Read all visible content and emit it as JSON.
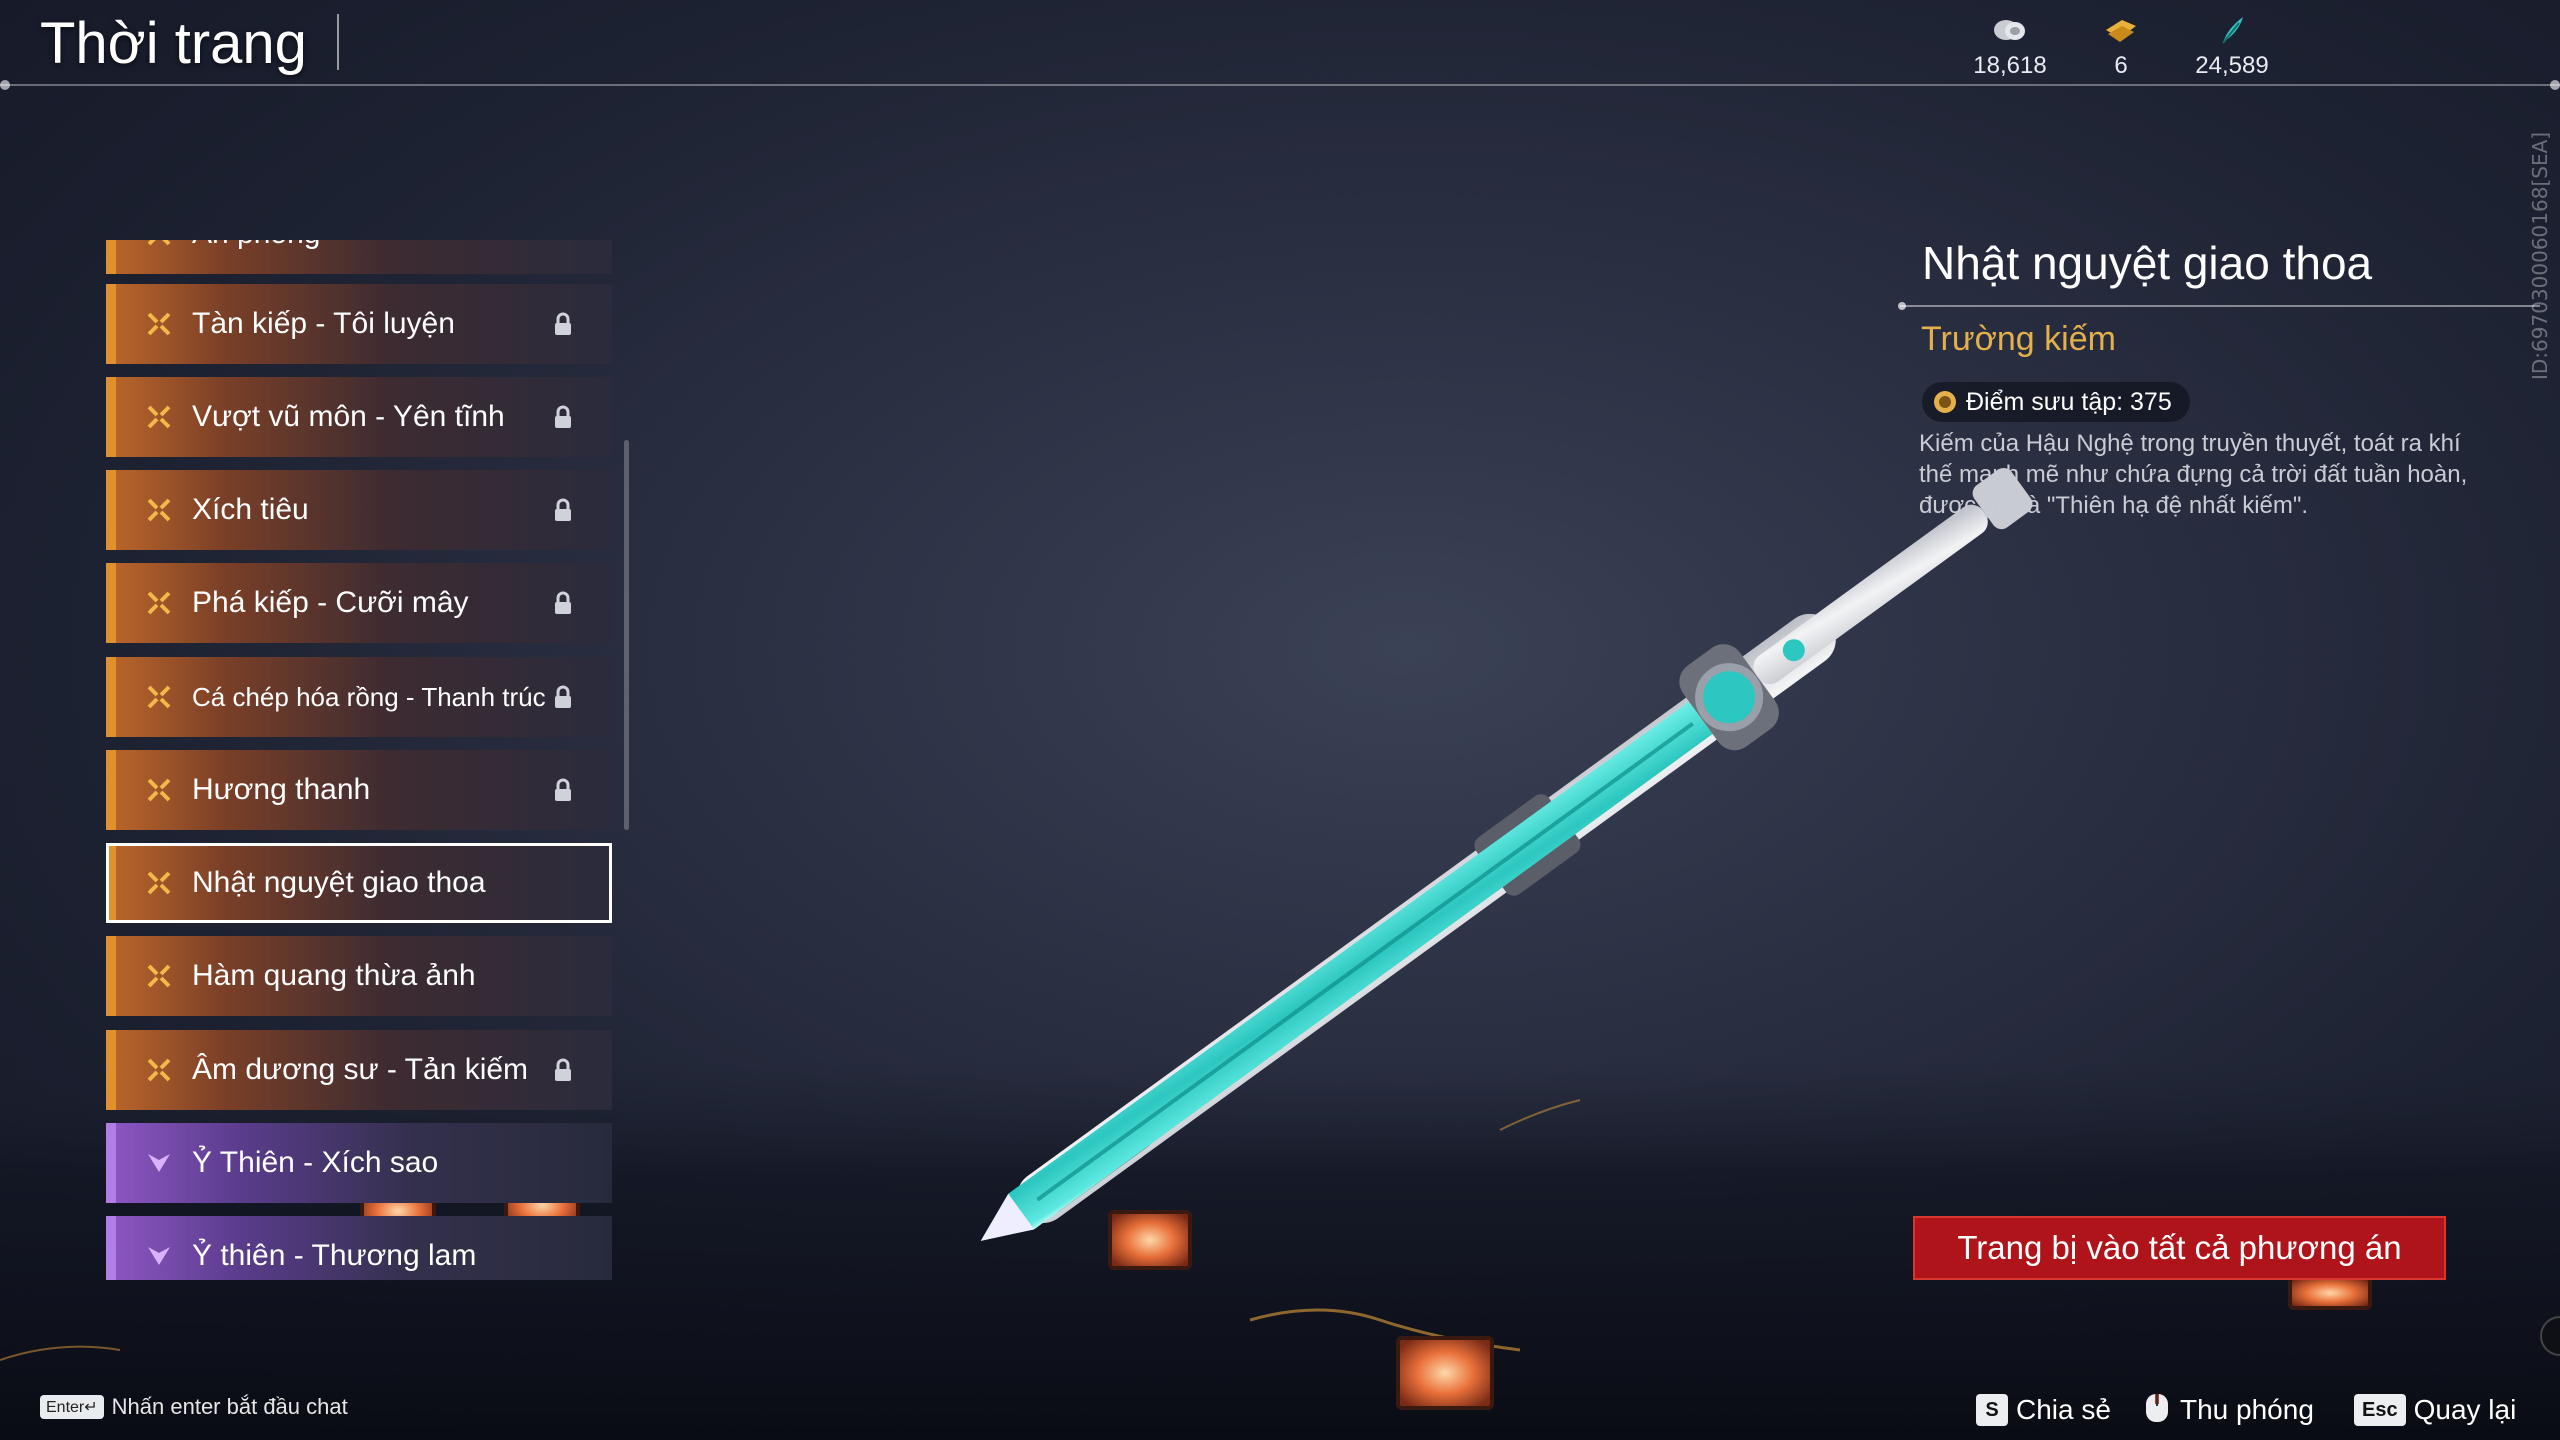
{
  "header": {
    "title": "Thời trang",
    "currencies": [
      {
        "icon": "silver-coin-icon",
        "value": "18,618"
      },
      {
        "icon": "gold-ticket-icon",
        "value": "6"
      },
      {
        "icon": "jade-feather-icon",
        "value": "24,589"
      }
    ]
  },
  "side_id": "ID:6970300060168[SEA]",
  "list": {
    "items": [
      {
        "label": "Ẩn phong",
        "rarity": "orange",
        "locked": false
      },
      {
        "label": "Tàn kiếp - Tôi luyện",
        "rarity": "orange",
        "locked": true
      },
      {
        "label": "Vượt vũ môn - Yên tĩnh",
        "rarity": "orange",
        "locked": true
      },
      {
        "label": "Xích tiêu",
        "rarity": "orange",
        "locked": true
      },
      {
        "label": "Phá kiếp - Cưỡi mây",
        "rarity": "orange",
        "locked": true
      },
      {
        "label": "Cá chép hóa rồng - Thanh trúc",
        "rarity": "orange",
        "locked": true
      },
      {
        "label": "Hương thanh",
        "rarity": "orange",
        "locked": true
      },
      {
        "label": "Nhật nguyệt giao thoa",
        "rarity": "orange",
        "locked": false,
        "selected": true
      },
      {
        "label": "Hàm quang thừa ảnh",
        "rarity": "orange",
        "locked": false
      },
      {
        "label": "Âm dương sư - Tản kiếm",
        "rarity": "orange",
        "locked": true
      },
      {
        "label": "Ỷ Thiên - Xích sao",
        "rarity": "purple",
        "locked": false
      },
      {
        "label": "Ỷ thiên - Thương lam",
        "rarity": "purple",
        "locked": false
      }
    ]
  },
  "detail": {
    "name": "Nhật nguyệt giao thoa",
    "type": "Trường kiếm",
    "collection_points": "Điểm sưu tập: 375",
    "description": "Kiếm của Hậu Nghệ trong truyền thuyết, toát ra khí thế mạnh mẽ như chứa đựng cả trời đất tuần hoàn, được gọi là \"Thiên hạ đệ nhất kiếm\".",
    "equip_button": "Trang bị vào tất cả phương án"
  },
  "footer": {
    "chat_key": "Enter↵",
    "chat_hint": "Nhấn enter bắt đầu chat",
    "actions": [
      {
        "key": "S",
        "label": "Chia sẻ"
      },
      {
        "key": "",
        "label": "Thu phóng"
      },
      {
        "key": "Esc",
        "label": "Quay lại"
      }
    ]
  },
  "colors": {
    "orange_rarity": "#e2902e",
    "purple_rarity": "#b07ee6",
    "accent_gold": "#e3b04b",
    "equip_red": "#b0141b",
    "blade_cyan": "#3fe0d8"
  }
}
